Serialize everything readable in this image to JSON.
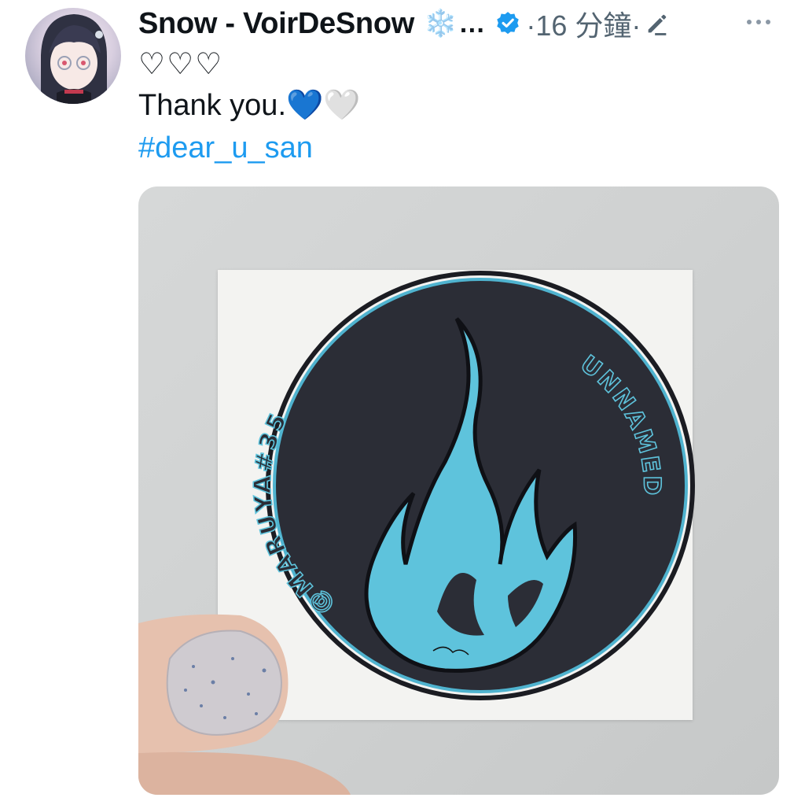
{
  "post": {
    "author_name": "Snow - VoirDeSnow",
    "author_emoji": "❄️",
    "truncation": "…",
    "time_meta": "·16 分鐘·",
    "line1": "♡♡♡",
    "line2": "Thank you.💙🤍",
    "hashtag": "#dear_u_san"
  },
  "sticker": {
    "left_text": "@MARUYA#35",
    "right_text": "UNNAMED"
  },
  "icons": {
    "verified": "verified-badge-icon",
    "edit": "edited-pencil-icon",
    "more": "more-options-icon"
  },
  "colors": {
    "verified": "#1d9bf0",
    "hashtag": "#1d9bf0",
    "flame": "#5ec3dc",
    "sticker_bg": "#2b2d36"
  }
}
